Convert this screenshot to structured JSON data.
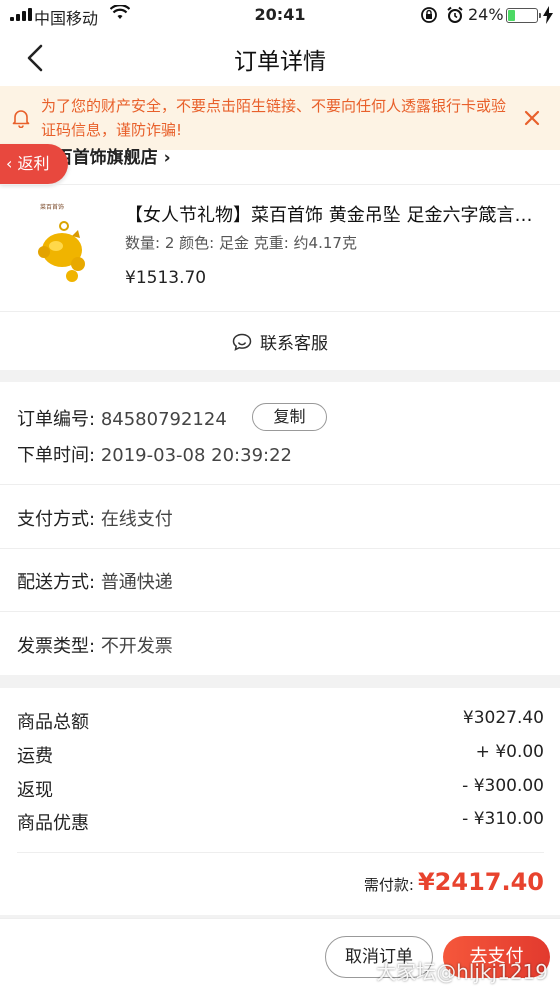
{
  "status_bar": {
    "carrier": "中国移动",
    "time": "20:41",
    "battery_percent_text": "24%",
    "battery_level": 0.24
  },
  "nav": {
    "title": "订单详情"
  },
  "notice": {
    "text": "为了您的财产安全，不要点击陌生链接、不要向任何人透露银行卡或验证码信息，谨防诈骗!"
  },
  "shop": {
    "name": "菜百首饰旗舰店 ›",
    "rebate_label": "返利"
  },
  "product": {
    "thumb_brand": "菜百首饰",
    "name": "【女人节礼物】菜百首饰 黄金吊坠 足金六字箴言金猪吊坠",
    "spec": "数量: 2 颜色: 足金 克重: 约4.17克",
    "price": "¥1513.70"
  },
  "service": {
    "label": "联系客服"
  },
  "order_info": {
    "order_no_label": "订单编号:",
    "order_no": "84580792124",
    "copy_label": "复制",
    "time_label": "下单时间:",
    "time": "2019-03-08 20:39:22",
    "payment_label": "支付方式:",
    "payment": "在线支付",
    "delivery_label": "配送方式:",
    "delivery": "普通快递",
    "invoice_label": "发票类型:",
    "invoice": "不开发票"
  },
  "summary": {
    "goods_total_label": "商品总额",
    "goods_total": "¥3027.40",
    "shipping_label": "运费",
    "shipping": "+ ¥0.00",
    "cashback_label": "返现",
    "cashback": "- ¥300.00",
    "discount_label": "商品优惠",
    "discount": "- ¥310.00",
    "need_pay_label": "需付款:",
    "need_pay": "¥2417.40"
  },
  "actions": {
    "cancel_label": "取消订单",
    "pay_label": "去支付"
  },
  "watermark": "大家坛@hljkj1219",
  "colors": {
    "accent_red": "#e8432e",
    "notice_text": "#e8602b",
    "notice_bg": "#fdf3e4"
  }
}
